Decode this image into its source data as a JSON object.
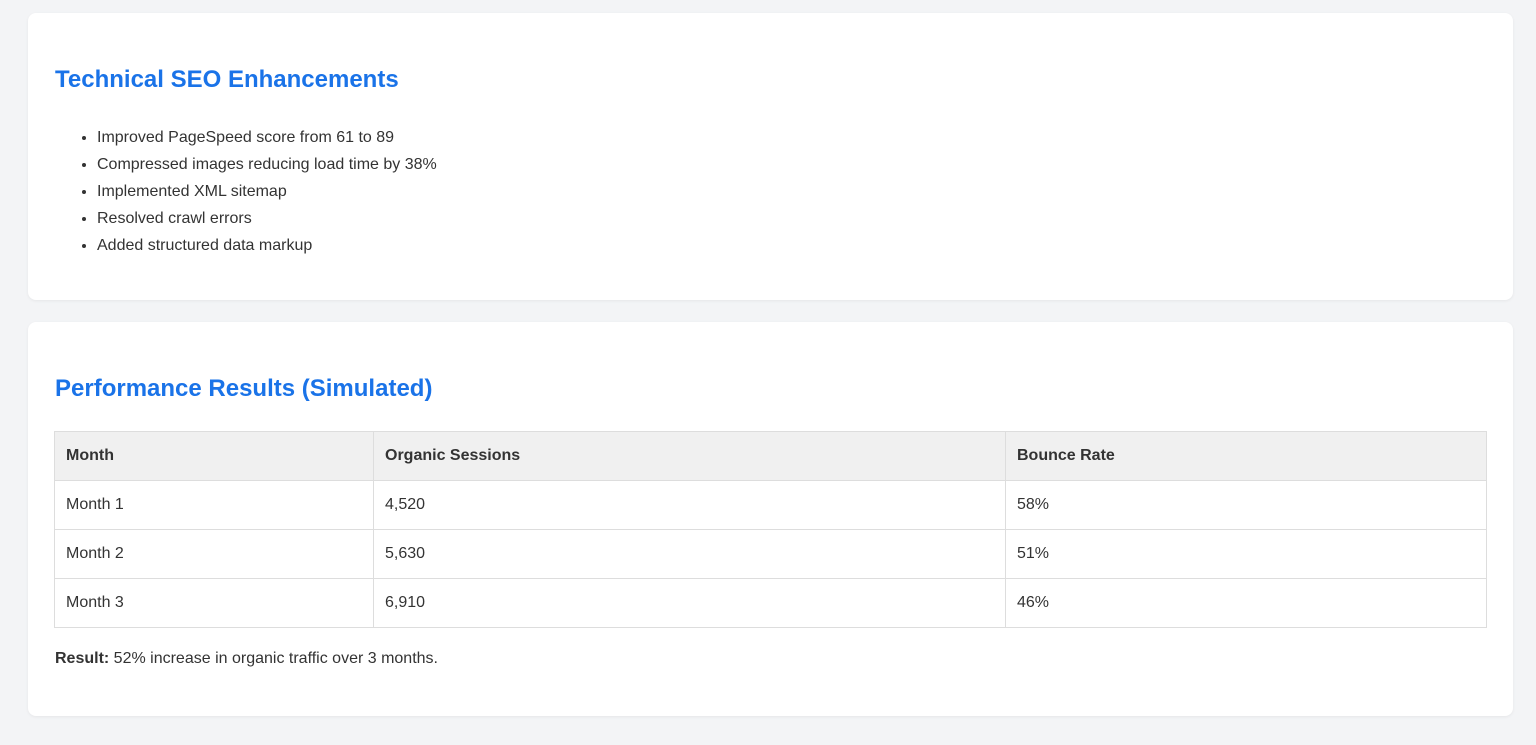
{
  "technical": {
    "title": "Technical SEO Enhancements",
    "items": [
      "Improved PageSpeed score from 61 to 89",
      "Compressed images reducing load time by 38%",
      "Implemented XML sitemap",
      "Resolved crawl errors",
      "Added structured data markup"
    ]
  },
  "performance": {
    "title": "Performance Results (Simulated)",
    "columns": [
      "Month",
      "Organic Sessions",
      "Bounce Rate"
    ],
    "rows": [
      [
        "Month 1",
        "4,520",
        "58%"
      ],
      [
        "Month 2",
        "5,630",
        "51%"
      ],
      [
        "Month 3",
        "6,910",
        "46%"
      ]
    ],
    "result_label": "Result:",
    "result_text": " 52% increase in organic traffic over 3 months."
  },
  "colors": {
    "accent": "#1a73e8",
    "background": "#f3f4f6",
    "table_header_bg": "#f0f0f0"
  }
}
